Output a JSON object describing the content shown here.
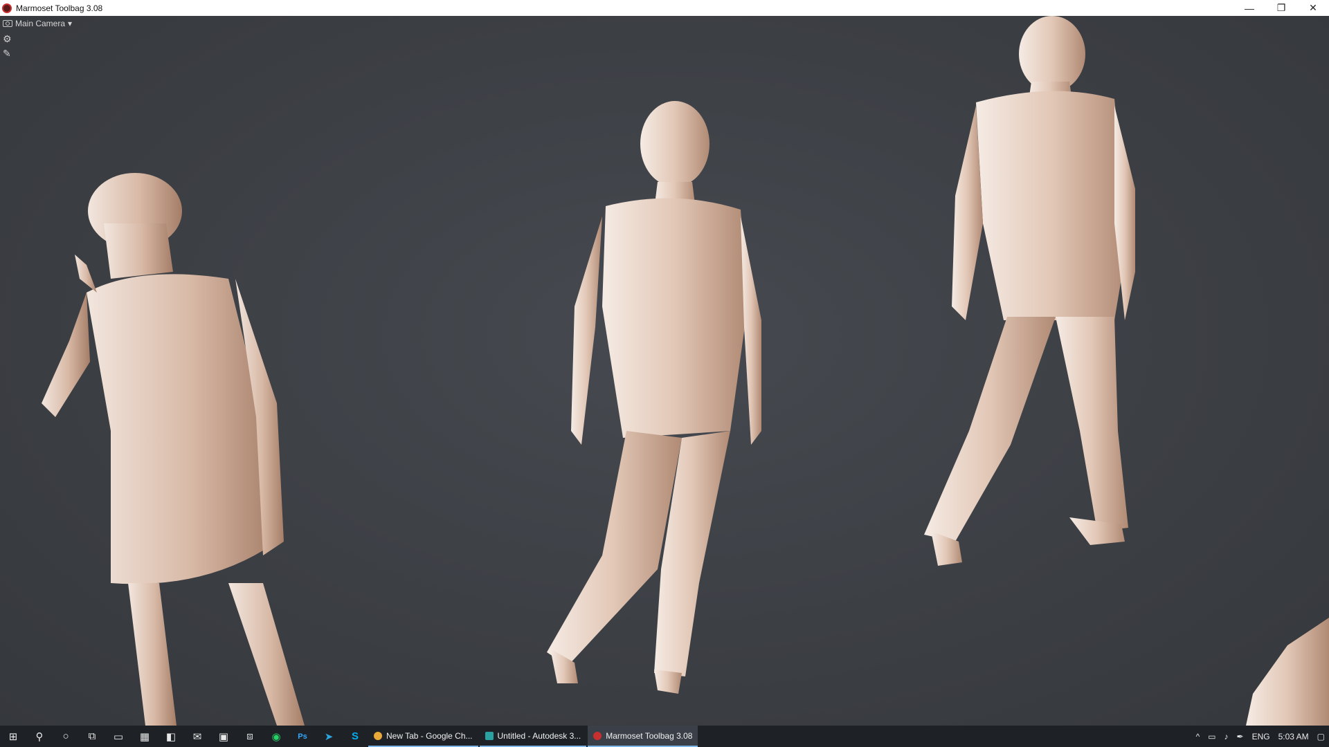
{
  "window": {
    "title": "Marmoset Toolbag 3.08",
    "minimize": "—",
    "restore": "❐",
    "close": "✕"
  },
  "viewport": {
    "camera_label": "Main Camera",
    "camera_dropdown_icon": "▾",
    "settings_icon": "⚙",
    "brush_icon": "✎"
  },
  "taskbar": {
    "start_icon": "⊞",
    "search_icon": "⚲",
    "cortana_icon": "○",
    "task_view_icon": "⧉",
    "pinned": [
      {
        "name": "file-explorer-icon",
        "glyph": "▭"
      },
      {
        "name": "calculator-icon",
        "glyph": "▦"
      },
      {
        "name": "store-icon",
        "glyph": "◧"
      },
      {
        "name": "mail-icon",
        "glyph": "✉"
      },
      {
        "name": "remote-desktop-icon",
        "glyph": "▣"
      },
      {
        "name": "network-icon",
        "glyph": "⧈"
      },
      {
        "name": "whatsapp-icon",
        "glyph": "◉"
      },
      {
        "name": "photoshop-icon",
        "glyph": "Ps"
      },
      {
        "name": "telegram-icon",
        "glyph": "➤"
      },
      {
        "name": "skype-icon",
        "glyph": "S"
      }
    ],
    "tasks": [
      {
        "label": "New Tab - Google Ch...",
        "color": "#e8a93a",
        "active": false
      },
      {
        "label": "Untitled - Autodesk 3...",
        "color": "#2aa0a0",
        "active": false
      },
      {
        "label": "Marmoset Toolbag 3.08",
        "color": "#c83030",
        "active": true
      }
    ],
    "tray": {
      "chevron": "^",
      "language": "ENG",
      "time": "5:03 AM"
    }
  },
  "colors": {
    "background": "#3a3d42",
    "figure_light": "#efe0d6",
    "figure_mid": "#c9a48e",
    "figure_shadow": "#8e6a55"
  }
}
